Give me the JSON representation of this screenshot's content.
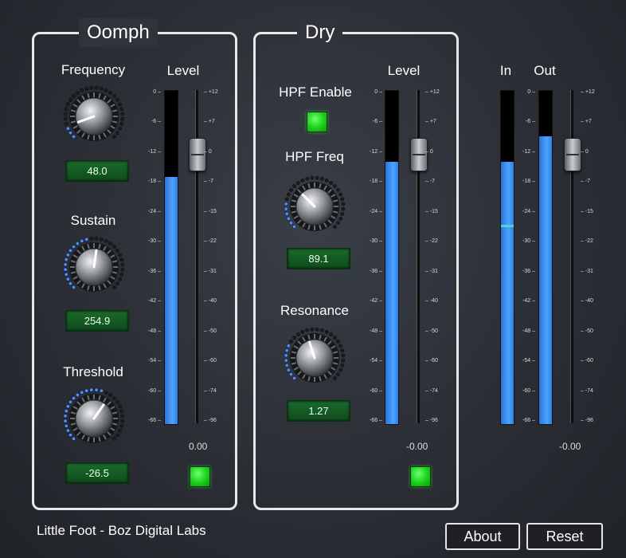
{
  "brand": "Little Foot - Boz Digital Labs",
  "colors": {
    "led": "#22dd22",
    "meter": "#3d8ff0",
    "readout": "#136027",
    "peak": "#46d9c9"
  },
  "oomph": {
    "title": "Oomph",
    "frequency": {
      "label": "Frequency",
      "value": "48.0"
    },
    "sustain": {
      "label": "Sustain",
      "value": "254.9"
    },
    "threshold": {
      "label": "Threshold",
      "value": "-26.5"
    },
    "level": {
      "label": "Level",
      "value": "0.00",
      "meter_level_db": -17,
      "fader_db": 0,
      "led_on": true
    }
  },
  "dry": {
    "title": "Dry",
    "hpf_enable": {
      "label": "HPF Enable",
      "on": true
    },
    "hpf_freq": {
      "label": "HPF Freq",
      "value": "89.1"
    },
    "resonance": {
      "label": "Resonance",
      "value": "1.27"
    },
    "level": {
      "label": "Level",
      "value": "-0.00",
      "meter_level_db": -14,
      "fader_db": 0,
      "led_on": true
    }
  },
  "output": {
    "in_label": "In",
    "out_label": "Out",
    "value": "-0.00",
    "in_level_db": -14,
    "in_peak_db": -27,
    "out_level_db": -9,
    "fader_db": 0
  },
  "meter_scale": [
    "0",
    "-6",
    "-12",
    "-18",
    "-24",
    "-30",
    "-36",
    "-42",
    "-48",
    "-54",
    "-60",
    "-66"
  ],
  "fader_scale": [
    "+12",
    "+7",
    "0",
    "-7",
    "-15",
    "-22",
    "-31",
    "-40",
    "-50",
    "-60",
    "-74",
    "-96"
  ],
  "buttons": {
    "about": "About",
    "reset": "Reset"
  }
}
